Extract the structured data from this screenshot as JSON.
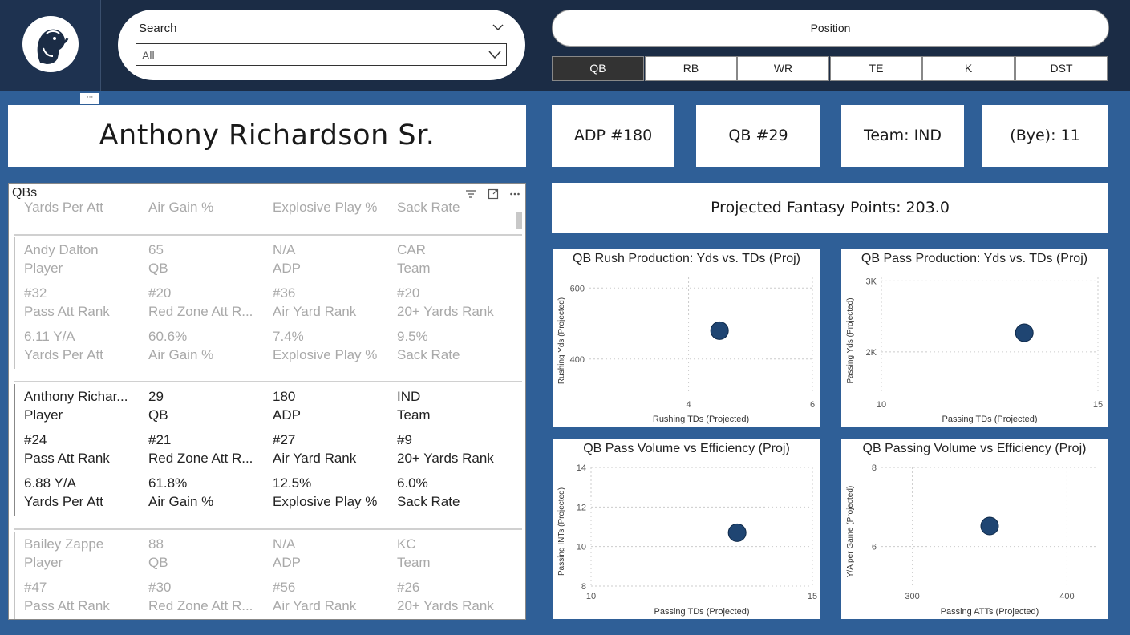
{
  "search": {
    "label": "Search",
    "value": "All"
  },
  "position": {
    "header": "Position",
    "tabs": [
      "QB",
      "RB",
      "WR",
      "TE",
      "K",
      "DST"
    ],
    "active": "QB"
  },
  "menu_dots": "···",
  "player": {
    "name": "Anthony Richardson Sr.",
    "adp": "ADP #180",
    "pos_rank": "QB #29",
    "team": "Team: IND",
    "bye": "(Bye): 11",
    "projected_points": "Projected Fantasy Points: 203.0"
  },
  "qbs_table": {
    "title": "QBs",
    "partial_top": [
      "Yards Per Att",
      "Air Gain %",
      "Explosive Play %",
      "Sack Rate"
    ],
    "rows": [
      {
        "selected": false,
        "lines": [
          [
            "Andy Dalton",
            "65",
            "N/A",
            "CAR"
          ],
          [
            "Player",
            "QB",
            "ADP",
            "Team"
          ],
          [
            "#32",
            "#20",
            "#36",
            "#20"
          ],
          [
            "Pass Att Rank",
            "Red Zone Att R...",
            "Air Yard Rank",
            "20+ Yards Rank"
          ],
          [
            "6.11 Y/A",
            "60.6%",
            "7.4%",
            "9.5%"
          ],
          [
            "Yards Per Att",
            "Air Gain %",
            "Explosive Play %",
            "Sack Rate"
          ]
        ]
      },
      {
        "selected": true,
        "lines": [
          [
            "Anthony Richar...",
            "29",
            "180",
            "IND"
          ],
          [
            "Player",
            "QB",
            "ADP",
            "Team"
          ],
          [
            "#24",
            "#21",
            "#27",
            "#9"
          ],
          [
            "Pass Att Rank",
            "Red Zone Att R...",
            "Air Yard Rank",
            "20+ Yards Rank"
          ],
          [
            "6.88 Y/A",
            "61.8%",
            "12.5%",
            "6.0%"
          ],
          [
            "Yards Per Att",
            "Air Gain %",
            "Explosive Play %",
            "Sack Rate"
          ]
        ]
      },
      {
        "selected": false,
        "lines": [
          [
            "Bailey Zappe",
            "88",
            "N/A",
            "KC"
          ],
          [
            "Player",
            "QB",
            "ADP",
            "Team"
          ],
          [
            "#47",
            "#30",
            "#56",
            "#26"
          ],
          [
            "Pass Att Rank",
            "Red Zone Att R...",
            "Air Yard Rank",
            "20+ Yards Rank"
          ]
        ]
      }
    ]
  },
  "colors": {
    "dot": "#1f4572",
    "grid": "#cccccc",
    "axis_text": "#555555"
  },
  "icons": [
    "filter-icon",
    "focus-mode-icon",
    "more-options-icon",
    "chevron-down-icon",
    "otter-logo-icon"
  ],
  "chart_data": [
    {
      "type": "scatter",
      "title": "QB Rush Production: Yds vs. TDs (Proj)",
      "xlabel": "Rushing TDs (Projected)",
      "ylabel": "Rushing Yds (Projected)",
      "xlim": [
        2.4,
        6
      ],
      "ylim": [
        300,
        630
      ],
      "xticks": [
        4,
        6
      ],
      "xtick_labels": [
        "4",
        "6"
      ],
      "yticks": [
        400,
        600
      ],
      "ytick_labels": [
        "400",
        "600"
      ],
      "points": [
        {
          "x": 4.5,
          "y": 480
        }
      ]
    },
    {
      "type": "scatter",
      "title": "QB Pass Production: Yds vs. TDs (Proj)",
      "xlabel": "Passing TDs (Projected)",
      "ylabel": "Passing Yds (Projected)",
      "xlim": [
        10,
        15
      ],
      "ylim": [
        1400,
        3050
      ],
      "xticks": [
        10,
        15
      ],
      "xtick_labels": [
        "10",
        "15"
      ],
      "yticks": [
        2000,
        3000
      ],
      "ytick_labels": [
        "2K",
        "3K"
      ],
      "points": [
        {
          "x": 13.3,
          "y": 2270
        }
      ]
    },
    {
      "type": "scatter",
      "title": "QB Pass Volume vs Efficiency (Proj)",
      "xlabel": "Passing TDs (Projected)",
      "ylabel": "Passing INTs (Projected)",
      "xlim": [
        10,
        15
      ],
      "ylim": [
        8,
        14
      ],
      "xticks": [
        10,
        15
      ],
      "xtick_labels": [
        "10",
        "15"
      ],
      "yticks": [
        8,
        10,
        12,
        14
      ],
      "ytick_labels": [
        "8",
        "10",
        "12",
        "14"
      ],
      "points": [
        {
          "x": 13.3,
          "y": 10.7
        }
      ]
    },
    {
      "type": "scatter",
      "title": "QB Passing Volume vs Efficiency (Proj)",
      "xlabel": "Passing ATTs (Projected)",
      "ylabel": "Y/A per Game (Projected)",
      "xlim": [
        280,
        420
      ],
      "ylim": [
        5.0,
        8.0
      ],
      "xticks": [
        300,
        400
      ],
      "xtick_labels": [
        "300",
        "400"
      ],
      "yticks": [
        6,
        8
      ],
      "ytick_labels": [
        "6",
        "8"
      ],
      "points": [
        {
          "x": 350,
          "y": 6.52
        }
      ]
    }
  ]
}
